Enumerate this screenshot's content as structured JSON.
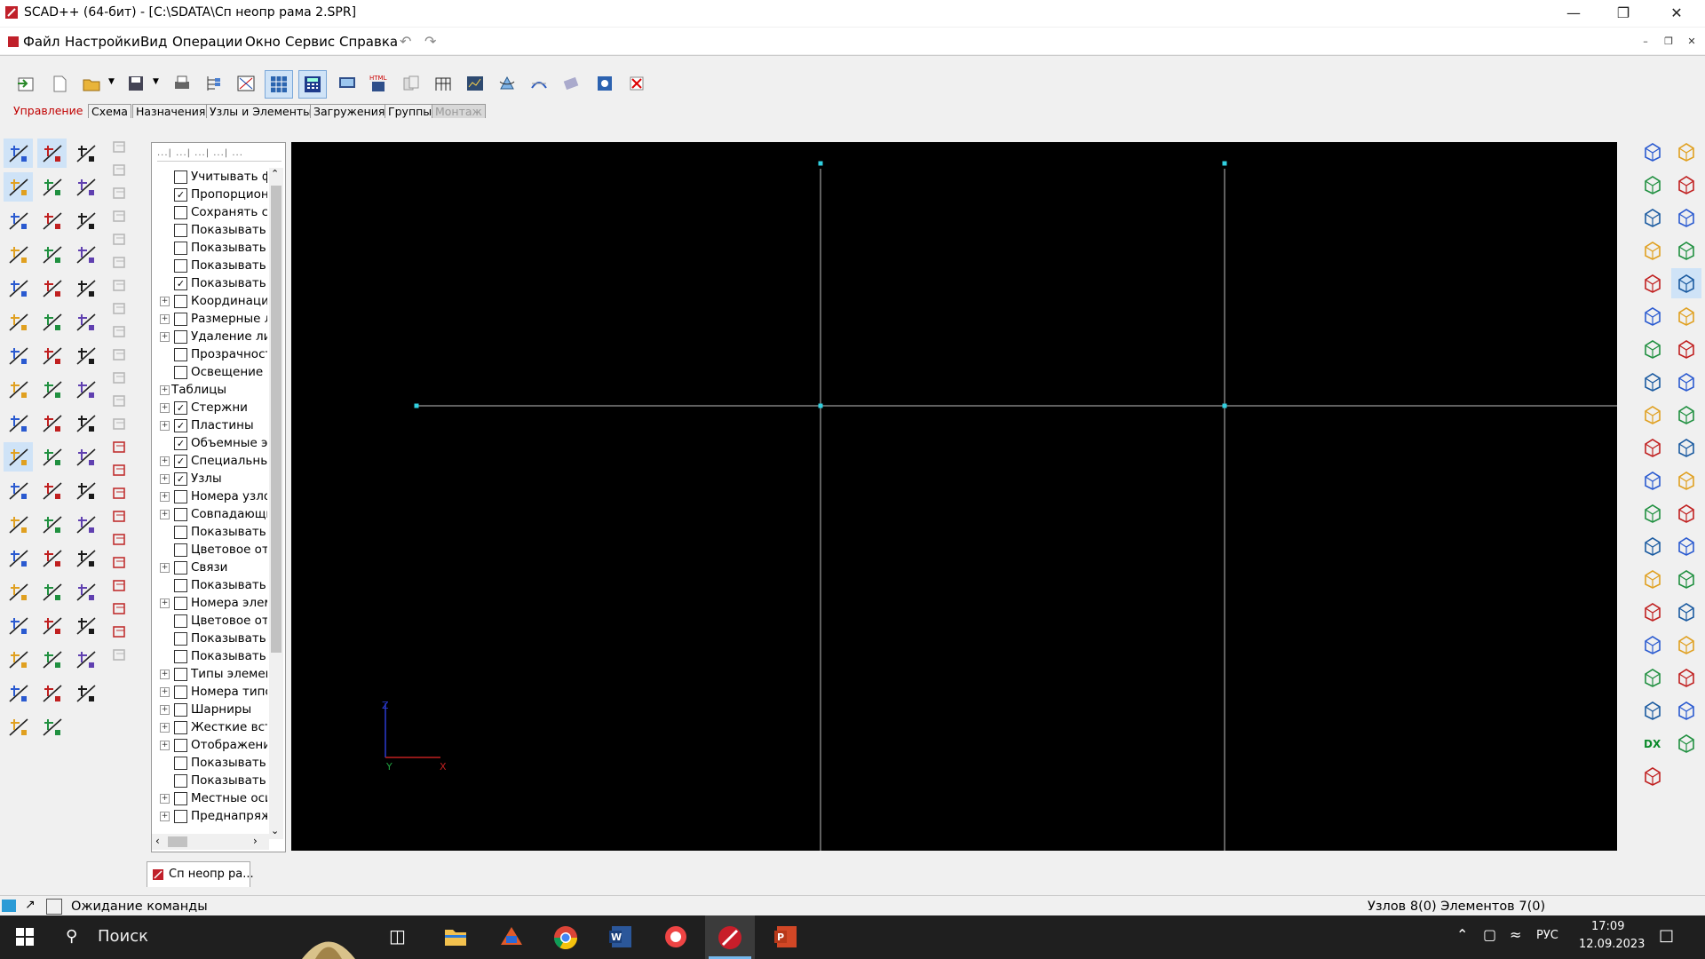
{
  "window": {
    "title": "SCAD++ (64-бит) - [C:\\SDATA\\Сп неопр рама 2.SPR]",
    "controls": [
      "minimize",
      "restore",
      "close"
    ]
  },
  "menu": {
    "items": [
      "Файл",
      "Настройки",
      "Вид",
      "Операции",
      "Окно",
      "Сервис",
      "Справка"
    ]
  },
  "tabs": {
    "items": [
      "Управление",
      "Схема",
      "Назначения",
      "Узлы и Элементы",
      "Загружения",
      "Группы",
      "Монтаж"
    ],
    "active": "Управление",
    "disabled": "Монтаж"
  },
  "tree": {
    "header_marks": "...| ...| ...| ...| ...",
    "rows": [
      {
        "label": "Учитывать ф",
        "checked": false,
        "expandable": false,
        "indent": 1
      },
      {
        "label": "Пропорцион",
        "checked": true,
        "expandable": false,
        "indent": 1
      },
      {
        "label": "Сохранять сс",
        "checked": false,
        "expandable": false,
        "indent": 1
      },
      {
        "label": "Показывать",
        "checked": false,
        "expandable": false,
        "indent": 1
      },
      {
        "label": "Показывать",
        "checked": false,
        "expandable": false,
        "indent": 1
      },
      {
        "label": "Показывать",
        "checked": false,
        "expandable": false,
        "indent": 1
      },
      {
        "label": "Показывать",
        "checked": true,
        "expandable": false,
        "indent": 1
      },
      {
        "label": "Координацио",
        "checked": false,
        "expandable": true,
        "indent": 1
      },
      {
        "label": "Размерные л",
        "checked": false,
        "expandable": true,
        "indent": 1
      },
      {
        "label": "Удаление ли",
        "checked": false,
        "expandable": true,
        "indent": 1
      },
      {
        "label": "Прозрачност",
        "checked": false,
        "expandable": false,
        "indent": 1
      },
      {
        "label": "Освещение",
        "checked": false,
        "expandable": false,
        "indent": 1
      },
      {
        "label": "Таблицы",
        "checked": null,
        "expandable": true,
        "indent": 0
      },
      {
        "label": "Стержни",
        "checked": true,
        "expandable": true,
        "indent": 1
      },
      {
        "label": "Пластины",
        "checked": true,
        "expandable": true,
        "indent": 1
      },
      {
        "label": "Объемные эл",
        "checked": true,
        "expandable": false,
        "indent": 1
      },
      {
        "label": "Специальные",
        "checked": true,
        "expandable": true,
        "indent": 1
      },
      {
        "label": "Узлы",
        "checked": true,
        "expandable": true,
        "indent": 1
      },
      {
        "label": "Номера узло",
        "checked": false,
        "expandable": true,
        "indent": 1
      },
      {
        "label": "Совпадающи",
        "checked": false,
        "expandable": true,
        "indent": 1
      },
      {
        "label": "Показывать",
        "checked": false,
        "expandable": false,
        "indent": 1
      },
      {
        "label": "Цветовое от",
        "checked": false,
        "expandable": false,
        "indent": 1
      },
      {
        "label": "Связи",
        "checked": false,
        "expandable": true,
        "indent": 1
      },
      {
        "label": "Показывать",
        "checked": false,
        "expandable": false,
        "indent": 1
      },
      {
        "label": "Номера элем",
        "checked": false,
        "expandable": true,
        "indent": 1
      },
      {
        "label": "Цветовое от",
        "checked": false,
        "expandable": false,
        "indent": 1
      },
      {
        "label": "Показывать",
        "checked": false,
        "expandable": false,
        "indent": 1
      },
      {
        "label": "Показывать",
        "checked": false,
        "expandable": false,
        "indent": 1
      },
      {
        "label": "Типы элемен",
        "checked": false,
        "expandable": true,
        "indent": 1
      },
      {
        "label": "Номера типо",
        "checked": false,
        "expandable": true,
        "indent": 1
      },
      {
        "label": "Шарниры",
        "checked": false,
        "expandable": true,
        "indent": 1
      },
      {
        "label": "Жесткие вст",
        "checked": false,
        "expandable": true,
        "indent": 1
      },
      {
        "label": "Отображени",
        "checked": false,
        "expandable": true,
        "indent": 1
      },
      {
        "label": "Показывать",
        "checked": false,
        "expandable": false,
        "indent": 1
      },
      {
        "label": "Показывать",
        "checked": false,
        "expandable": false,
        "indent": 1
      },
      {
        "label": "Местные оси",
        "checked": false,
        "expandable": true,
        "indent": 1
      },
      {
        "label": "Преднапряж",
        "checked": false,
        "expandable": true,
        "indent": 1
      }
    ]
  },
  "canvas": {
    "background": "#000000",
    "line_color": "#bfbfbf",
    "node_color": "#31d0e0",
    "axis_labels": {
      "z": "Z",
      "y": "Y",
      "x": "X"
    }
  },
  "document_tab": {
    "label": "Сп неопр ра..."
  },
  "status": {
    "left": "Ожидание команды",
    "right": "Узлов 8(0) Элементов 7(0)"
  },
  "taskbar": {
    "search_placeholder": "Поиск",
    "lang": "РУС",
    "time": "17:09",
    "date": "12.09.2023"
  },
  "colors": {
    "accent_red": "#c00000",
    "highlight_blue": "#cfe3f7"
  }
}
